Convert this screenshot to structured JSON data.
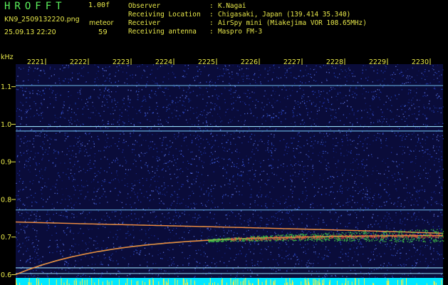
{
  "header": {
    "app_title": "HROFFT",
    "version": "1.00f",
    "filename": "KN9_2509132220.png",
    "timestamp": "25.09.13 22:20",
    "mode_label": "meteor",
    "mode_value": "59"
  },
  "info": [
    {
      "key": "Observer",
      "sep": ":",
      "value": "K.Nagai"
    },
    {
      "key": "Receiving Location",
      "sep": ":",
      "value": "Chigasaki, Japan (139.414 35.340)"
    },
    {
      "key": "Receiver",
      "sep": ":",
      "value": "AirSpy mini (Miakejima VOR 108.65MHz)"
    },
    {
      "key": "Receiving antenna",
      "sep": ":",
      "value": "Maspro FM-3"
    }
  ],
  "colors": {
    "text": "#e8e84a",
    "title": "#5cf25c",
    "background": "#000000",
    "noise_base": "#0a0c3a",
    "carrier_line": "#7ad0ff",
    "meteor_echo": "#ff6a3c",
    "band_bottom": "#00e6ff"
  },
  "chart_data": {
    "type": "heatmap",
    "ylabel": "kHz",
    "x_ticks": [
      "2221",
      "2222",
      "2223",
      "2224",
      "2225",
      "2226",
      "2227",
      "2228",
      "2229",
      "2230"
    ],
    "y_ticks": [
      "1.1",
      "1.0",
      "0.9",
      "0.8",
      "0.7",
      "0.6"
    ],
    "ylim": [
      0.58,
      1.16
    ],
    "xlim": [
      0,
      10
    ],
    "carrier_lines_khz": [
      1.103,
      0.994,
      0.982,
      0.772,
      0.618,
      0.603
    ],
    "echo_descending": {
      "from_khz": 0.74,
      "to_khz": 0.71
    },
    "echo_ascending": {
      "from_khz": 0.6,
      "to_khz": 0.705
    }
  }
}
